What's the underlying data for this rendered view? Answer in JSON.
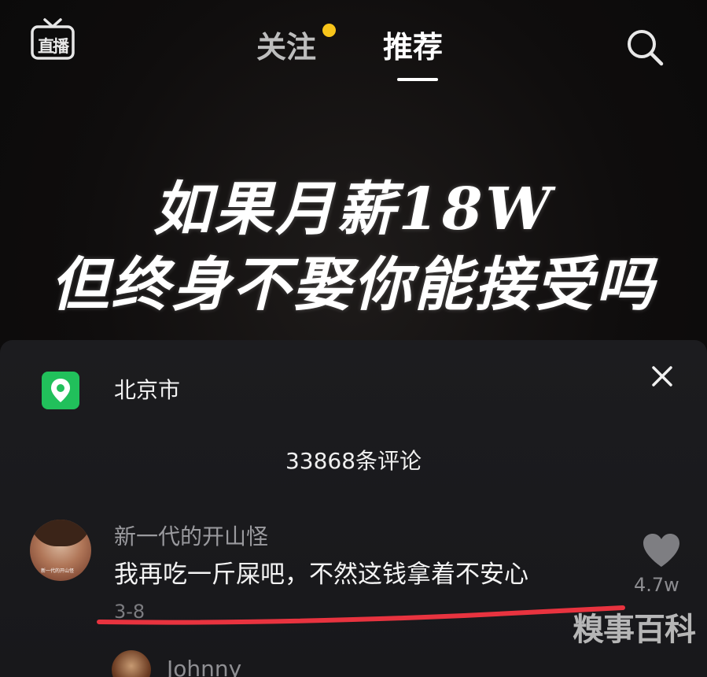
{
  "topbar": {
    "live_label": "直播",
    "tab_follow": "关注",
    "tab_recommend": "推荐",
    "active_tab": "推荐",
    "notify_dot_color": "#f7c41a"
  },
  "video": {
    "caption_line1": "如果月薪18W",
    "caption_line2": "但终身不娶你能接受吗"
  },
  "comment_panel": {
    "location": "北京市",
    "location_icon": "map-pin-icon",
    "location_icon_color": "#21c05b",
    "comment_count_label": "33868条评论",
    "comments": [
      {
        "user": "新一代的开山怪",
        "text": "我再吃一斤屎吧，不然这钱拿着不安心",
        "date": "3-8",
        "likes": "4.7w",
        "avatar_caption": "新一代的开山怪"
      },
      {
        "user": "Johnny"
      }
    ],
    "highlight_color": "#e8333f"
  },
  "watermark": "糗事百科"
}
